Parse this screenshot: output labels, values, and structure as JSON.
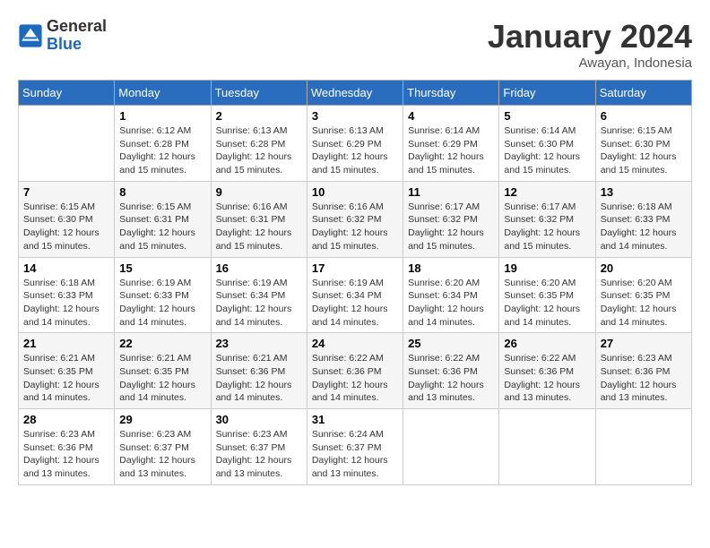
{
  "header": {
    "logo_general": "General",
    "logo_blue": "Blue",
    "month_title": "January 2024",
    "location": "Awayan, Indonesia"
  },
  "days_of_week": [
    "Sunday",
    "Monday",
    "Tuesday",
    "Wednesday",
    "Thursday",
    "Friday",
    "Saturday"
  ],
  "weeks": [
    [
      {
        "day": "",
        "sunrise": "",
        "sunset": "",
        "daylight": ""
      },
      {
        "day": "1",
        "sunrise": "6:12 AM",
        "sunset": "6:28 PM",
        "daylight": "12 hours and 15 minutes."
      },
      {
        "day": "2",
        "sunrise": "6:13 AM",
        "sunset": "6:28 PM",
        "daylight": "12 hours and 15 minutes."
      },
      {
        "day": "3",
        "sunrise": "6:13 AM",
        "sunset": "6:29 PM",
        "daylight": "12 hours and 15 minutes."
      },
      {
        "day": "4",
        "sunrise": "6:14 AM",
        "sunset": "6:29 PM",
        "daylight": "12 hours and 15 minutes."
      },
      {
        "day": "5",
        "sunrise": "6:14 AM",
        "sunset": "6:30 PM",
        "daylight": "12 hours and 15 minutes."
      },
      {
        "day": "6",
        "sunrise": "6:15 AM",
        "sunset": "6:30 PM",
        "daylight": "12 hours and 15 minutes."
      }
    ],
    [
      {
        "day": "7",
        "sunrise": "6:15 AM",
        "sunset": "6:30 PM",
        "daylight": "12 hours and 15 minutes."
      },
      {
        "day": "8",
        "sunrise": "6:15 AM",
        "sunset": "6:31 PM",
        "daylight": "12 hours and 15 minutes."
      },
      {
        "day": "9",
        "sunrise": "6:16 AM",
        "sunset": "6:31 PM",
        "daylight": "12 hours and 15 minutes."
      },
      {
        "day": "10",
        "sunrise": "6:16 AM",
        "sunset": "6:32 PM",
        "daylight": "12 hours and 15 minutes."
      },
      {
        "day": "11",
        "sunrise": "6:17 AM",
        "sunset": "6:32 PM",
        "daylight": "12 hours and 15 minutes."
      },
      {
        "day": "12",
        "sunrise": "6:17 AM",
        "sunset": "6:32 PM",
        "daylight": "12 hours and 15 minutes."
      },
      {
        "day": "13",
        "sunrise": "6:18 AM",
        "sunset": "6:33 PM",
        "daylight": "12 hours and 14 minutes."
      }
    ],
    [
      {
        "day": "14",
        "sunrise": "6:18 AM",
        "sunset": "6:33 PM",
        "daylight": "12 hours and 14 minutes."
      },
      {
        "day": "15",
        "sunrise": "6:19 AM",
        "sunset": "6:33 PM",
        "daylight": "12 hours and 14 minutes."
      },
      {
        "day": "16",
        "sunrise": "6:19 AM",
        "sunset": "6:34 PM",
        "daylight": "12 hours and 14 minutes."
      },
      {
        "day": "17",
        "sunrise": "6:19 AM",
        "sunset": "6:34 PM",
        "daylight": "12 hours and 14 minutes."
      },
      {
        "day": "18",
        "sunrise": "6:20 AM",
        "sunset": "6:34 PM",
        "daylight": "12 hours and 14 minutes."
      },
      {
        "day": "19",
        "sunrise": "6:20 AM",
        "sunset": "6:35 PM",
        "daylight": "12 hours and 14 minutes."
      },
      {
        "day": "20",
        "sunrise": "6:20 AM",
        "sunset": "6:35 PM",
        "daylight": "12 hours and 14 minutes."
      }
    ],
    [
      {
        "day": "21",
        "sunrise": "6:21 AM",
        "sunset": "6:35 PM",
        "daylight": "12 hours and 14 minutes."
      },
      {
        "day": "22",
        "sunrise": "6:21 AM",
        "sunset": "6:35 PM",
        "daylight": "12 hours and 14 minutes."
      },
      {
        "day": "23",
        "sunrise": "6:21 AM",
        "sunset": "6:36 PM",
        "daylight": "12 hours and 14 minutes."
      },
      {
        "day": "24",
        "sunrise": "6:22 AM",
        "sunset": "6:36 PM",
        "daylight": "12 hours and 14 minutes."
      },
      {
        "day": "25",
        "sunrise": "6:22 AM",
        "sunset": "6:36 PM",
        "daylight": "12 hours and 13 minutes."
      },
      {
        "day": "26",
        "sunrise": "6:22 AM",
        "sunset": "6:36 PM",
        "daylight": "12 hours and 13 minutes."
      },
      {
        "day": "27",
        "sunrise": "6:23 AM",
        "sunset": "6:36 PM",
        "daylight": "12 hours and 13 minutes."
      }
    ],
    [
      {
        "day": "28",
        "sunrise": "6:23 AM",
        "sunset": "6:36 PM",
        "daylight": "12 hours and 13 minutes."
      },
      {
        "day": "29",
        "sunrise": "6:23 AM",
        "sunset": "6:37 PM",
        "daylight": "12 hours and 13 minutes."
      },
      {
        "day": "30",
        "sunrise": "6:23 AM",
        "sunset": "6:37 PM",
        "daylight": "12 hours and 13 minutes."
      },
      {
        "day": "31",
        "sunrise": "6:24 AM",
        "sunset": "6:37 PM",
        "daylight": "12 hours and 13 minutes."
      },
      {
        "day": "",
        "sunrise": "",
        "sunset": "",
        "daylight": ""
      },
      {
        "day": "",
        "sunrise": "",
        "sunset": "",
        "daylight": ""
      },
      {
        "day": "",
        "sunrise": "",
        "sunset": "",
        "daylight": ""
      }
    ]
  ]
}
